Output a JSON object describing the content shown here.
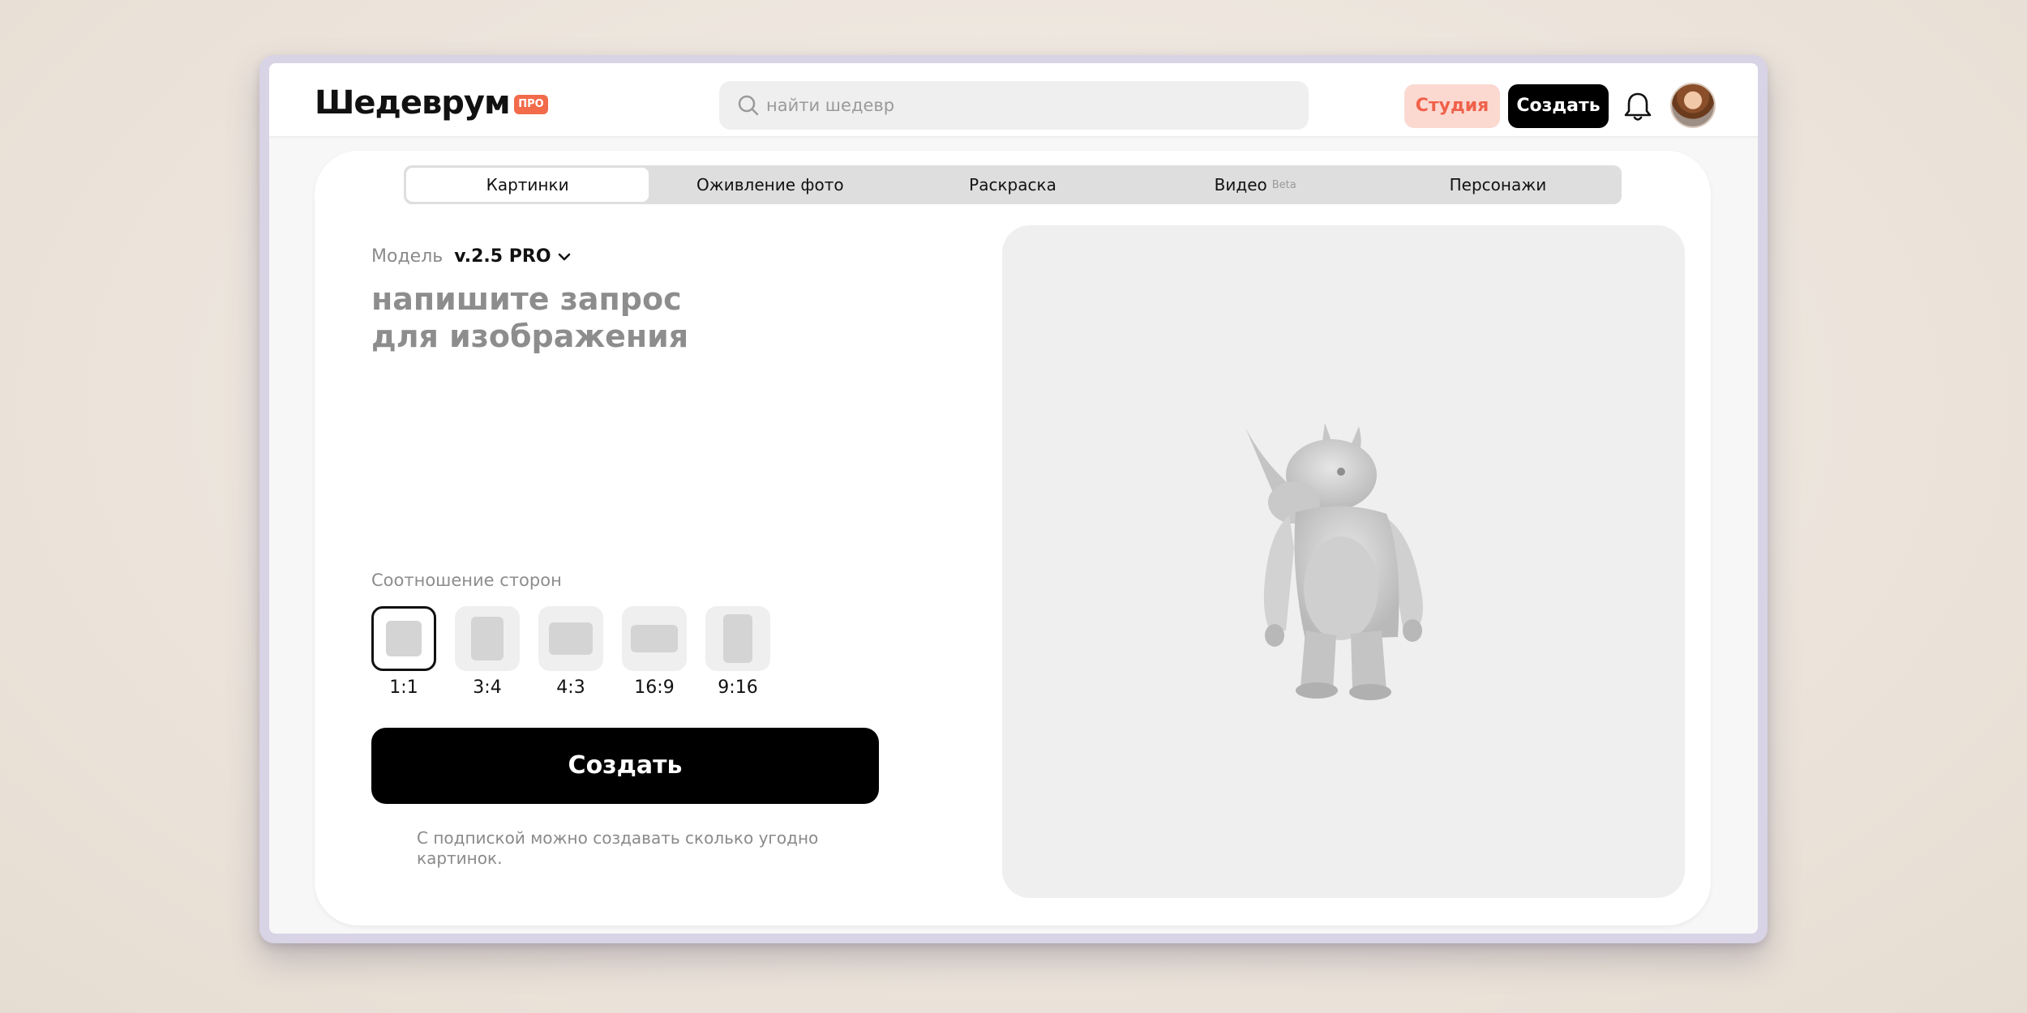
{
  "header": {
    "logo": "Шедеврум",
    "badge": "ПРО",
    "search": {
      "placeholder": "найти шедевр"
    },
    "studio_label": "Студия",
    "create_label": "Создать"
  },
  "tabs": [
    {
      "label": "Картинки",
      "active": true
    },
    {
      "label": "Оживление фото",
      "active": false
    },
    {
      "label": "Раскраска",
      "active": false
    },
    {
      "label": "Видео",
      "badge": "Beta",
      "active": false
    },
    {
      "label": "Персонажи",
      "active": false
    }
  ],
  "form": {
    "model_label": "Модель",
    "model_value": "v.2.5 PRO",
    "prompt_placeholder": "напишите запрос\nдля изображения",
    "ratio_title": "Соотношение сторон",
    "ratios": [
      {
        "label": "1:1",
        "selected": true
      },
      {
        "label": "3:4",
        "selected": false
      },
      {
        "label": "4:3",
        "selected": false
      },
      {
        "label": "16:9",
        "selected": false
      },
      {
        "label": "9:16",
        "selected": false
      }
    ],
    "create_label": "Создать",
    "note": "С подпиской можно создавать сколько угодно картинок."
  },
  "preview": {
    "image": "rhino-in-jacket-illustration"
  },
  "colors": {
    "accent": "#f26b4b",
    "studio_bg": "#fbd9d1",
    "primary": "#000000",
    "muted_text": "#8d8d8d"
  }
}
